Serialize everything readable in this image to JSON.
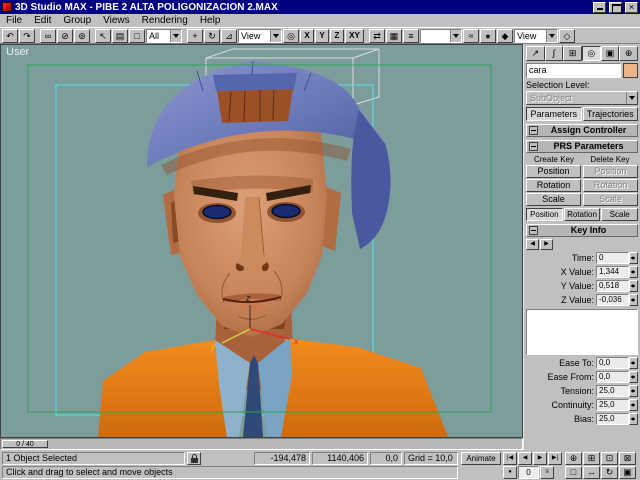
{
  "window": {
    "title": "3D Studio MAX - PIBE 2 ALTA POLIGONIZACION 2.MAX"
  },
  "menu": {
    "items": [
      "File",
      "Edit",
      "Group",
      "Views",
      "Rendering",
      "Help"
    ]
  },
  "icons": {
    "close": "×",
    "undo": "↶",
    "redo": "↷",
    "link": "∞",
    "unlink": "⊘",
    "bind": "⊚",
    "select": "↖",
    "select_by_name": "▤",
    "region": "□",
    "move": "+",
    "rotate": "↻",
    "scale": "⊿",
    "center": "◎",
    "mirror": "⇄",
    "array": "▦",
    "align": "≡",
    "trackview": "≈",
    "material": "●",
    "render": "◆",
    "render_last": "◇",
    "prev": "◀",
    "next": "▶"
  },
  "toolbar": {
    "filter_dropdown": "All",
    "coord_dropdown": "View",
    "named_dropdown": "",
    "view_dropdown": "View",
    "axis_x": "X",
    "axis_y": "Y",
    "axis_z": "Z",
    "axis_xy": "XY"
  },
  "panel_tabs": {
    "create": "↗",
    "modify": "∫",
    "hierarchy": "⊞",
    "motion": "◎",
    "display": "▣",
    "utilities": "⊕"
  },
  "viewport": {
    "label": "User",
    "axis_x": "x",
    "axis_y": "y",
    "axis_z": "z"
  },
  "panel": {
    "object_name": "cara",
    "selection_level_label": "Selection Level:",
    "subobject_label": "SubObject",
    "parameters_tab": "Parameters",
    "trajectories_tab": "Trajectories",
    "assign_controller": "Assign Controller",
    "prs_parameters": "PRS Parameters",
    "key_info": "Key Info",
    "create_key_label": "Create Key",
    "delete_key_label": "Delete Key",
    "create_position": "Position",
    "create_rotation": "Rotation",
    "create_scale": "Scale",
    "delete_position": "Position",
    "delete_rotation": "Rotation",
    "delete_scale": "Scale",
    "mode_position": "Position",
    "mode_rotation": "Rotation",
    "mode_scale": "Scale",
    "time_label": "Time:",
    "time_value": "0",
    "x_label": "X Value:",
    "x_value": "1,344",
    "y_label": "Y Value:",
    "y_value": "0,518",
    "z_label": "Z Value:",
    "z_value": "-0,036",
    "ease_to_label": "Ease To:",
    "ease_to_value": "0,0",
    "ease_from_label": "Ease From:",
    "ease_from_value": "0,0",
    "tension_label": "Tension:",
    "tension_value": "25,0",
    "continuity_label": "Continuity:",
    "continuity_value": "25,0",
    "bias_label": "Bias:",
    "bias_value": "25,0"
  },
  "timeline": {
    "slider_label": "0 / 40"
  },
  "vcr": {
    "go_start": "|◀",
    "prev": "◀",
    "play": "▶",
    "go_end": "▶|",
    "key": "●",
    "frame": "0",
    "config": "≡"
  },
  "nav": {
    "zoom": "⊕",
    "zoom_all": "⊞",
    "zoom_ext": "⊡",
    "zoom_ext_all": "⊠",
    "region": "□",
    "pan": "↔",
    "arc": "↻",
    "minmax": "▣"
  },
  "statusbar": {
    "selection": "1 Object Selected",
    "coord_x": "-194,478",
    "coord_y": "1140,406",
    "coord_z": "0,0",
    "grid": "Grid = 10,0",
    "prompt": "Click and drag to select and move objects",
    "animate_label": "Animate"
  },
  "colors": {
    "titlebar": "#000080",
    "chrome": "#c0c0c0",
    "viewport_bg": "#7d9c9c",
    "safe_frame_green": "#2aa64e",
    "wireframe_cyan": "#49e8e8",
    "cap_blue": "#6a77b8",
    "jacket_orange": "#e8811c",
    "skin": "#c8845a",
    "object_color_swatch": "#edb489"
  }
}
